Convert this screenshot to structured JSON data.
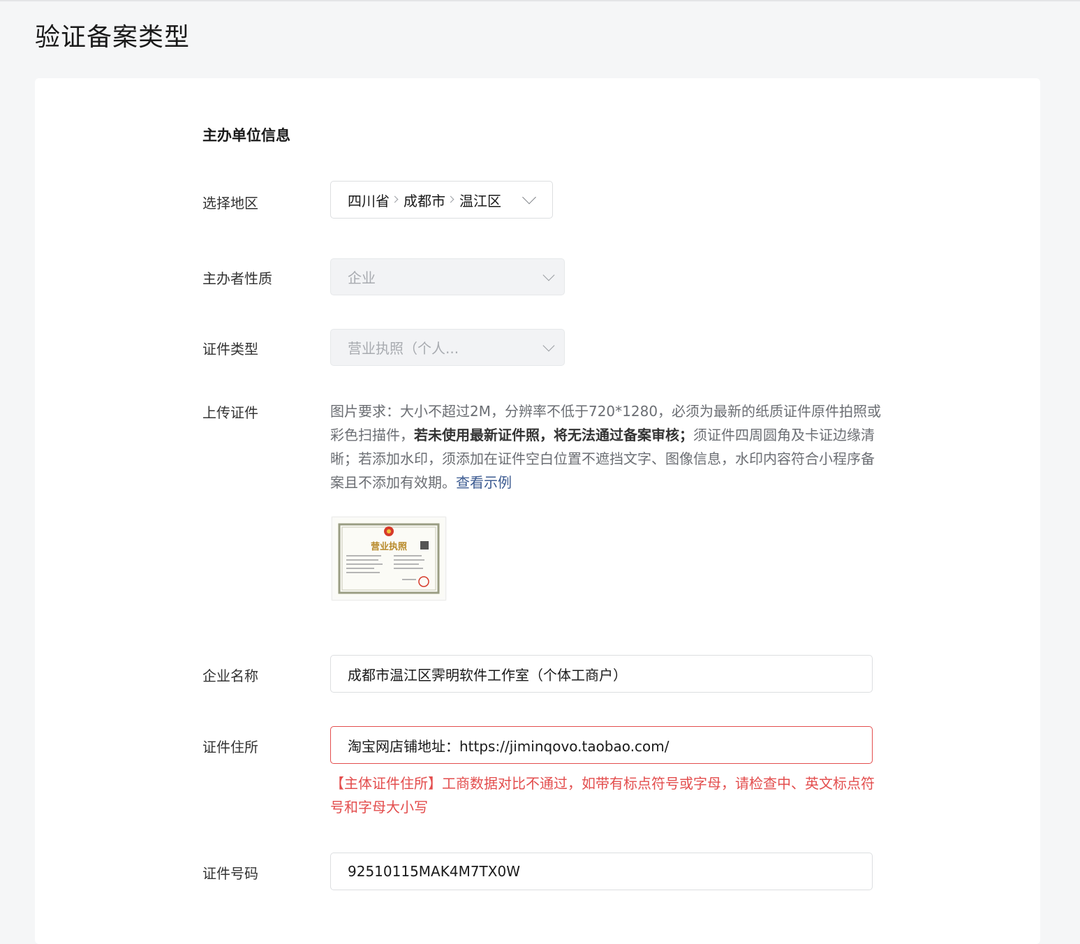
{
  "page": {
    "title": "验证备案类型"
  },
  "section": {
    "title": "主办单位信息"
  },
  "region": {
    "label": "选择地区",
    "province": "四川省",
    "city": "成都市",
    "district": "温江区"
  },
  "host_nature": {
    "label": "主办者性质",
    "value": "企业"
  },
  "cert_type": {
    "label": "证件类型",
    "value": "营业执照（个人..."
  },
  "upload": {
    "label": "上传证件",
    "desc_part1": "图片要求：大小不超过2M，分辨率不低于720*1280，必须为最新的纸质证件原件拍照或彩色扫描件，",
    "desc_bold": "若未使用最新证件照，将无法通过备案审核；",
    "desc_part2": "须证件四周圆角及卡证边缘清晰；若添加水印，须添加在证件空白位置不遮挡文字、图像信息，水印内容符合小程序备案且不添加有效期。",
    "link": "查看示例",
    "thumbnail_caption": "营业执照"
  },
  "company_name": {
    "label": "企业名称",
    "value": "成都市温江区霁明软件工作室（个体工商户）"
  },
  "cert_address": {
    "label": "证件住所",
    "value": "淘宝网店铺地址：https://jiminqovo.taobao.com/",
    "error": "【主体证件住所】工商数据对比不通过，如带有标点符号或字母，请检查中、英文标点符号和字母大小写"
  },
  "cert_number": {
    "label": "证件号码",
    "value": "92510115MAK4M7TX0W"
  },
  "colors": {
    "error": "#e34d4d",
    "link": "#3c5b91",
    "background": "#f5f6f7"
  }
}
